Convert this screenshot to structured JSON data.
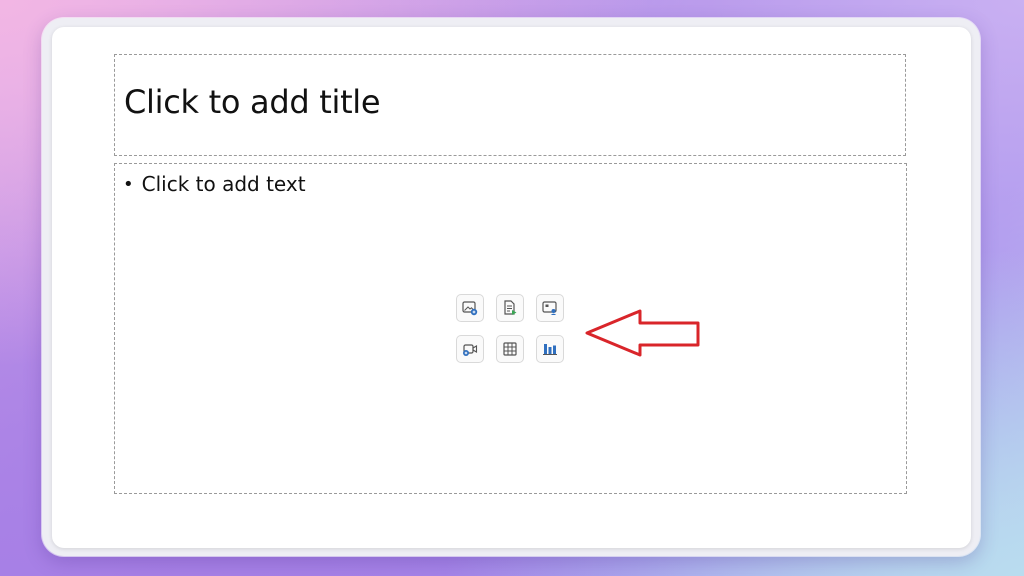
{
  "slide": {
    "title_placeholder": "Click to add title",
    "body_placeholder": "Click to add text",
    "bullet": "•"
  },
  "insert_icons": [
    {
      "name": "insert-pictures-icon"
    },
    {
      "name": "insert-from-file-icon"
    },
    {
      "name": "insert-cameo-icon"
    },
    {
      "name": "insert-video-icon"
    },
    {
      "name": "insert-table-icon"
    },
    {
      "name": "insert-chart-icon"
    }
  ],
  "annotation": {
    "arrow_color": "#d9252a"
  },
  "colors": {
    "icon_blue": "#2f6fbf",
    "icon_green": "#3aa655"
  }
}
